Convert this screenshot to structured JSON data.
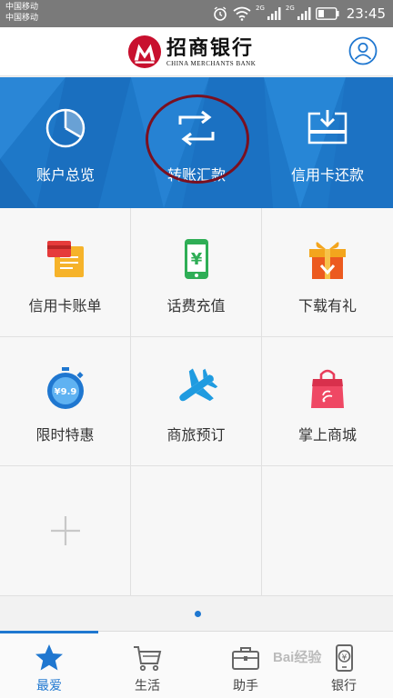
{
  "status_bar": {
    "carrier_1": "中国移动",
    "carrier_2": "中国移动",
    "net_1": "2G",
    "net_2": "2G",
    "time": "23:45"
  },
  "header": {
    "logo_cn": "招商银行",
    "logo_en": "CHINA MERCHANTS BANK"
  },
  "banner": {
    "items": [
      {
        "label": "账户总览",
        "icon": "pie-chart-icon"
      },
      {
        "label": "转账汇款",
        "icon": "transfer-arrows-icon"
      },
      {
        "label": "信用卡还款",
        "icon": "card-repay-icon"
      }
    ]
  },
  "grid": {
    "items": [
      {
        "label": "信用卡账单",
        "icon": "card-bill-icon"
      },
      {
        "label": "话费充值",
        "icon": "phone-topup-icon"
      },
      {
        "label": "下载有礼",
        "icon": "gift-download-icon"
      },
      {
        "label": "限时特惠",
        "icon": "stopwatch-deal-icon",
        "badge": "¥9.9"
      },
      {
        "label": "商旅预订",
        "icon": "airplane-icon"
      },
      {
        "label": "掌上商城",
        "icon": "shopping-bag-icon"
      }
    ]
  },
  "tabbar": {
    "tabs": [
      {
        "label": "最爱",
        "icon": "star-icon",
        "active": true
      },
      {
        "label": "生活",
        "icon": "cart-icon",
        "active": false
      },
      {
        "label": "助手",
        "icon": "briefcase-icon",
        "active": false
      },
      {
        "label": "银行",
        "icon": "bank-phone-icon",
        "active": false
      }
    ]
  },
  "watermark": "Bai经验",
  "colors": {
    "brand_red": "#c8102e",
    "banner_blue": "#1e78c8",
    "accent_blue": "#1f77d0",
    "annotation_circle": "#7a1020"
  }
}
